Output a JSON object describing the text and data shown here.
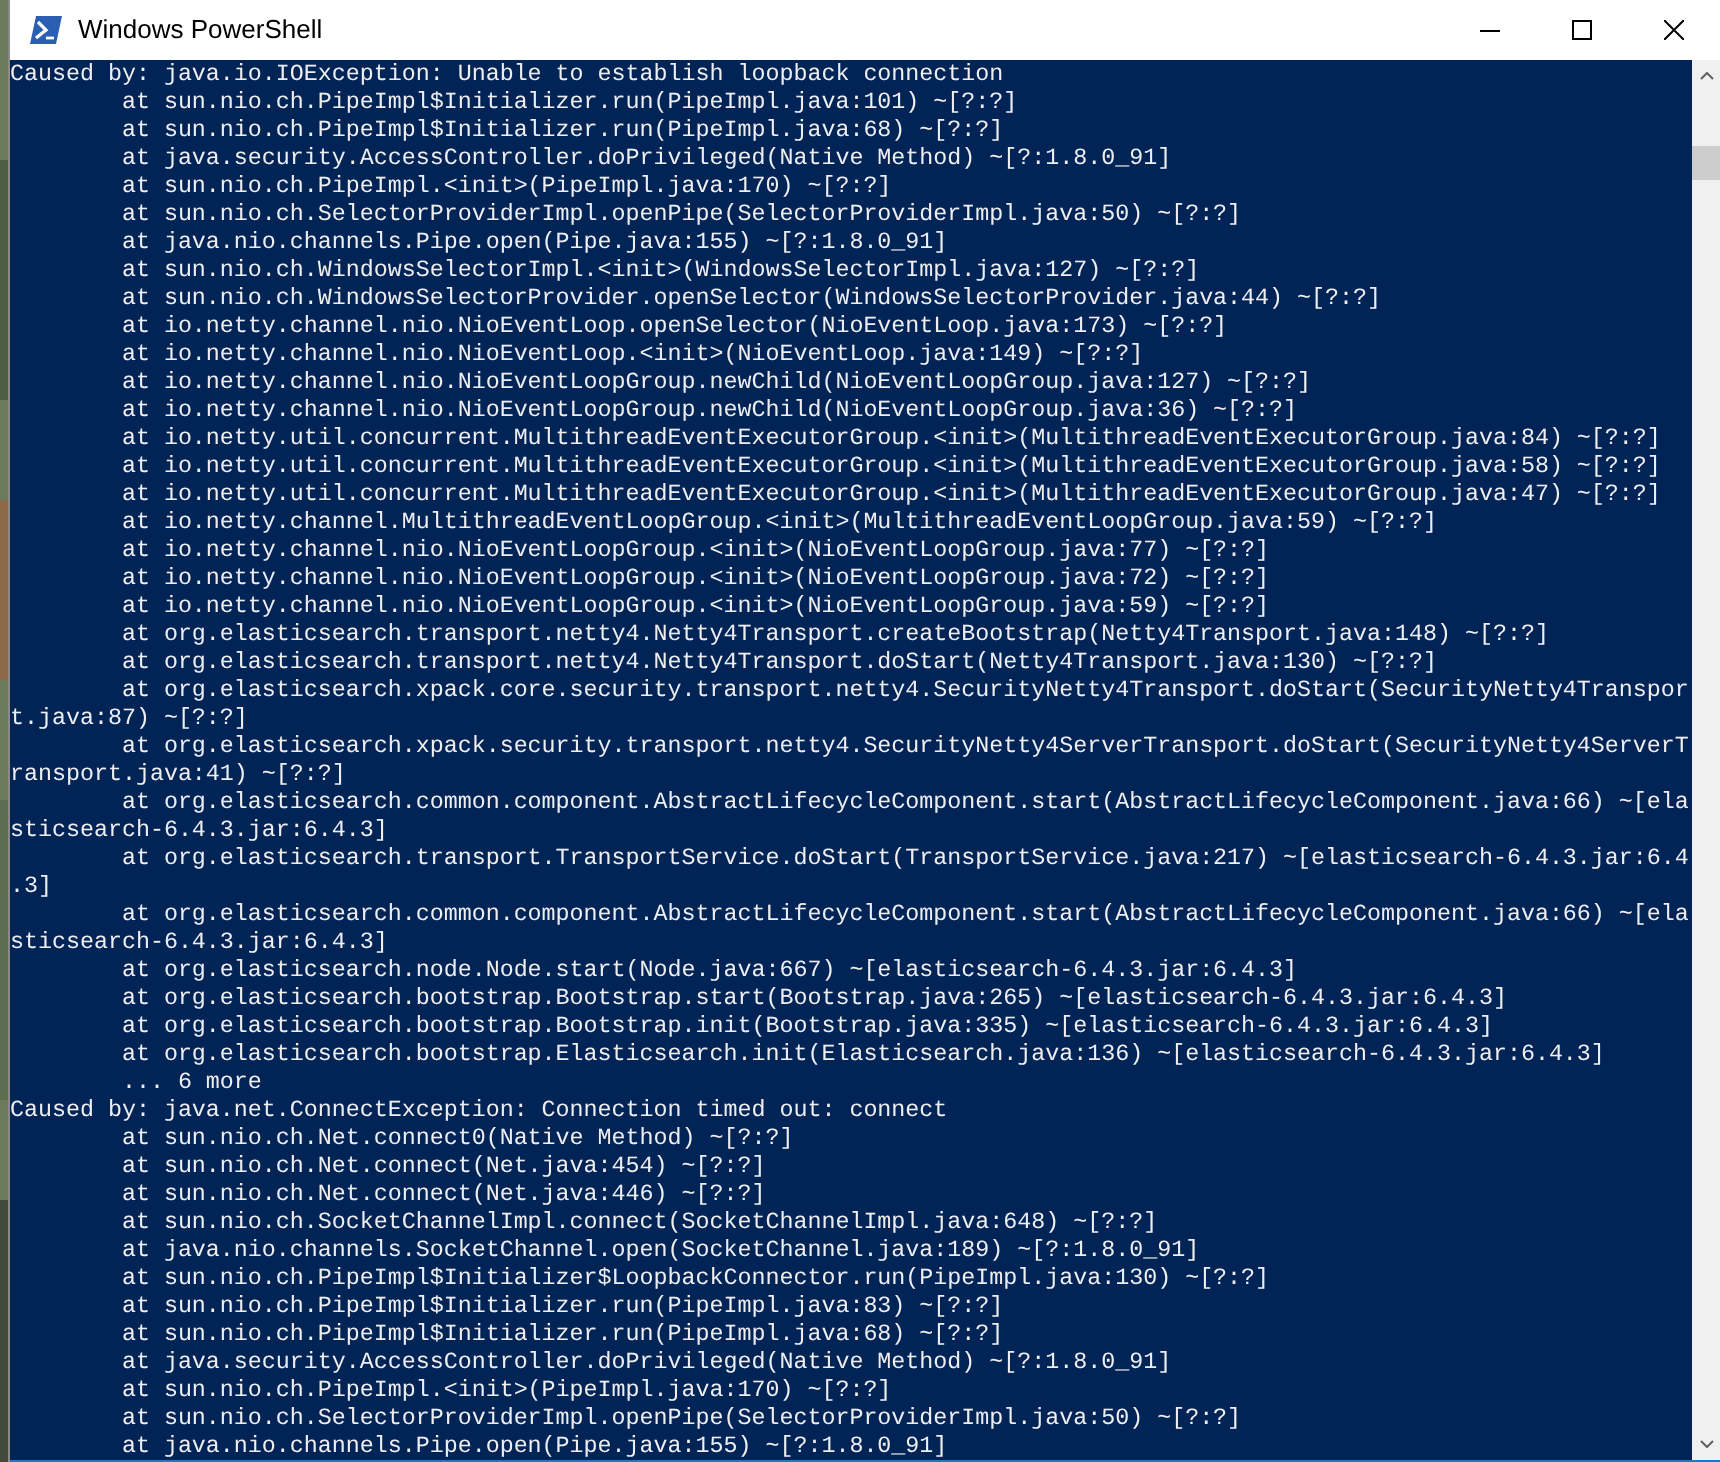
{
  "window": {
    "title": "Windows PowerShell"
  },
  "console": {
    "lines": [
      "Caused by: java.io.IOException: Unable to establish loopback connection",
      "        at sun.nio.ch.PipeImpl$Initializer.run(PipeImpl.java:101) ~[?:?]",
      "        at sun.nio.ch.PipeImpl$Initializer.run(PipeImpl.java:68) ~[?:?]",
      "        at java.security.AccessController.doPrivileged(Native Method) ~[?:1.8.0_91]",
      "        at sun.nio.ch.PipeImpl.<init>(PipeImpl.java:170) ~[?:?]",
      "        at sun.nio.ch.SelectorProviderImpl.openPipe(SelectorProviderImpl.java:50) ~[?:?]",
      "        at java.nio.channels.Pipe.open(Pipe.java:155) ~[?:1.8.0_91]",
      "        at sun.nio.ch.WindowsSelectorImpl.<init>(WindowsSelectorImpl.java:127) ~[?:?]",
      "        at sun.nio.ch.WindowsSelectorProvider.openSelector(WindowsSelectorProvider.java:44) ~[?:?]",
      "        at io.netty.channel.nio.NioEventLoop.openSelector(NioEventLoop.java:173) ~[?:?]",
      "        at io.netty.channel.nio.NioEventLoop.<init>(NioEventLoop.java:149) ~[?:?]",
      "        at io.netty.channel.nio.NioEventLoopGroup.newChild(NioEventLoopGroup.java:127) ~[?:?]",
      "        at io.netty.channel.nio.NioEventLoopGroup.newChild(NioEventLoopGroup.java:36) ~[?:?]",
      "        at io.netty.util.concurrent.MultithreadEventExecutorGroup.<init>(MultithreadEventExecutorGroup.java:84) ~[?:?]",
      "        at io.netty.util.concurrent.MultithreadEventExecutorGroup.<init>(MultithreadEventExecutorGroup.java:58) ~[?:?]",
      "        at io.netty.util.concurrent.MultithreadEventExecutorGroup.<init>(MultithreadEventExecutorGroup.java:47) ~[?:?]",
      "        at io.netty.channel.MultithreadEventLoopGroup.<init>(MultithreadEventLoopGroup.java:59) ~[?:?]",
      "        at io.netty.channel.nio.NioEventLoopGroup.<init>(NioEventLoopGroup.java:77) ~[?:?]",
      "        at io.netty.channel.nio.NioEventLoopGroup.<init>(NioEventLoopGroup.java:72) ~[?:?]",
      "        at io.netty.channel.nio.NioEventLoopGroup.<init>(NioEventLoopGroup.java:59) ~[?:?]",
      "        at org.elasticsearch.transport.netty4.Netty4Transport.createBootstrap(Netty4Transport.java:148) ~[?:?]",
      "        at org.elasticsearch.transport.netty4.Netty4Transport.doStart(Netty4Transport.java:130) ~[?:?]",
      "        at org.elasticsearch.xpack.core.security.transport.netty4.SecurityNetty4Transport.doStart(SecurityNetty4Transpor",
      "t.java:87) ~[?:?]",
      "        at org.elasticsearch.xpack.security.transport.netty4.SecurityNetty4ServerTransport.doStart(SecurityNetty4ServerT",
      "ransport.java:41) ~[?:?]",
      "        at org.elasticsearch.common.component.AbstractLifecycleComponent.start(AbstractLifecycleComponent.java:66) ~[ela",
      "sticsearch-6.4.3.jar:6.4.3]",
      "        at org.elasticsearch.transport.TransportService.doStart(TransportService.java:217) ~[elasticsearch-6.4.3.jar:6.4",
      ".3]",
      "        at org.elasticsearch.common.component.AbstractLifecycleComponent.start(AbstractLifecycleComponent.java:66) ~[ela",
      "sticsearch-6.4.3.jar:6.4.3]",
      "        at org.elasticsearch.node.Node.start(Node.java:667) ~[elasticsearch-6.4.3.jar:6.4.3]",
      "        at org.elasticsearch.bootstrap.Bootstrap.start(Bootstrap.java:265) ~[elasticsearch-6.4.3.jar:6.4.3]",
      "        at org.elasticsearch.bootstrap.Bootstrap.init(Bootstrap.java:335) ~[elasticsearch-6.4.3.jar:6.4.3]",
      "        at org.elasticsearch.bootstrap.Elasticsearch.init(Elasticsearch.java:136) ~[elasticsearch-6.4.3.jar:6.4.3]",
      "        ... 6 more",
      "Caused by: java.net.ConnectException: Connection timed out: connect",
      "        at sun.nio.ch.Net.connect0(Native Method) ~[?:?]",
      "        at sun.nio.ch.Net.connect(Net.java:454) ~[?:?]",
      "        at sun.nio.ch.Net.connect(Net.java:446) ~[?:?]",
      "        at sun.nio.ch.SocketChannelImpl.connect(SocketChannelImpl.java:648) ~[?:?]",
      "        at java.nio.channels.SocketChannel.open(SocketChannel.java:189) ~[?:1.8.0_91]",
      "        at sun.nio.ch.PipeImpl$Initializer$LoopbackConnector.run(PipeImpl.java:130) ~[?:?]",
      "        at sun.nio.ch.PipeImpl$Initializer.run(PipeImpl.java:83) ~[?:?]",
      "        at sun.nio.ch.PipeImpl$Initializer.run(PipeImpl.java:68) ~[?:?]",
      "        at java.security.AccessController.doPrivileged(Native Method) ~[?:1.8.0_91]",
      "        at sun.nio.ch.PipeImpl.<init>(PipeImpl.java:170) ~[?:?]",
      "        at sun.nio.ch.SelectorProviderImpl.openPipe(SelectorProviderImpl.java:50) ~[?:?]",
      "        at java.nio.channels.Pipe.open(Pipe.java:155) ~[?:1.8.0_91]"
    ]
  }
}
